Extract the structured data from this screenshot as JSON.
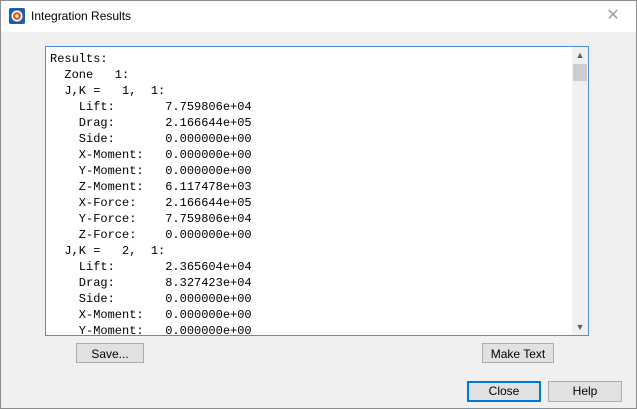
{
  "window": {
    "title": "Integration Results",
    "close_glyph": "✕"
  },
  "results": {
    "lines": [
      "Results:",
      "  Zone   1:",
      "  J,K =   1,  1:",
      "    Lift:       7.759806e+04",
      "    Drag:       2.166644e+05",
      "    Side:       0.000000e+00",
      "    X-Moment:   0.000000e+00",
      "    Y-Moment:   0.000000e+00",
      "    Z-Moment:   6.117478e+03",
      "    X-Force:    2.166644e+05",
      "    Y-Force:    7.759806e+04",
      "    Z-Force:    0.000000e+00",
      "  J,K =   2,  1:",
      "    Lift:       2.365604e+04",
      "    Drag:       8.327423e+04",
      "    Side:       0.000000e+00",
      "    X-Moment:   0.000000e+00",
      "    Y-Moment:   0.000000e+00"
    ]
  },
  "buttons": {
    "save": "Save...",
    "make_text": "Make Text",
    "close": "Close",
    "help": "Help"
  },
  "icons": {
    "app": "app-logo-icon",
    "close": "close-icon",
    "scroll_up": "scroll-up-icon",
    "scroll_down": "scroll-down-icon"
  },
  "colors": {
    "accent": "#0078d7",
    "text_border": "#4e8fd8",
    "dialog_bg": "#f0f0f0"
  }
}
